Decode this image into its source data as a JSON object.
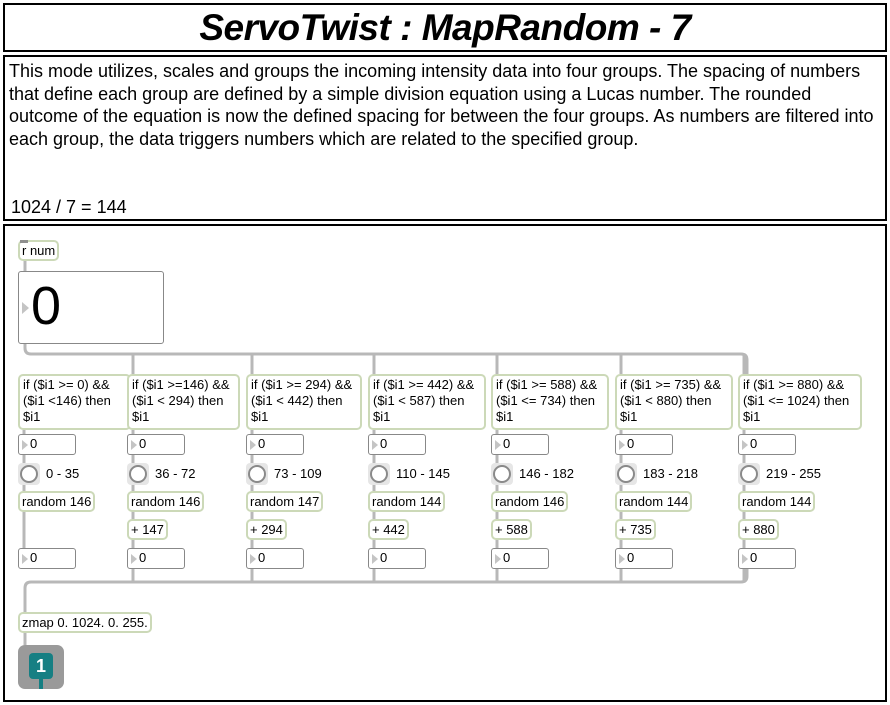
{
  "title": "ServoTwist : MapRandom - 7",
  "description": "This mode utilizes, scales and groups the incoming intensity data into four groups. The spacing of numbers that define each group are defined by a simple division equation using a Lucas number. The rounded outcome of the equation is now the defined spacing for between the four groups. As numbers are filtered into each group, the data triggers numbers which are related to the specified group.",
  "formula": "1024 / 7 = 144",
  "patch": {
    "receive": "r num",
    "big_number": "0",
    "columns": [
      {
        "expr": "if ($i1 >= 0) && ($i1 <146) then $i1",
        "num_in": "0",
        "range": "0 - 35",
        "random": "random 146",
        "add": "",
        "num_out": "0"
      },
      {
        "expr": "if ($i1 >=146) && ($i1 < 294) then $i1",
        "num_in": "0",
        "range": "36 - 72",
        "random": "random 146",
        "add": "+ 147",
        "num_out": "0"
      },
      {
        "expr": "if ($i1 >= 294) && ($i1 < 442) then $i1",
        "num_in": "0",
        "range": "73 - 109",
        "random": "random 147",
        "add": "+ 294",
        "num_out": "0"
      },
      {
        "expr": "if ($i1 >= 442) && ($i1 < 587) then $i1",
        "num_in": "0",
        "range": "110 - 145",
        "random": "random 144",
        "add": "+ 442",
        "num_out": "0"
      },
      {
        "expr": "if ($i1 >= 588) && ($i1 <= 734) then $i1",
        "num_in": "0",
        "range": "146 - 182",
        "random": "random 146",
        "add": "+ 588",
        "num_out": "0"
      },
      {
        "expr": "if ($i1 >= 735) && ($i1 < 880) then $i1",
        "num_in": "0",
        "range": "183 - 218",
        "random": "random 144",
        "add": "+ 735",
        "num_out": "0"
      },
      {
        "expr": "if ($i1 >= 880) && ($i1 <= 1024) then $i1",
        "num_in": "0",
        "range": "219 - 255",
        "random": "random 144",
        "add": "+ 880",
        "num_out": "0"
      }
    ],
    "zmap": "zmap 0. 1024. 0. 255.",
    "output_toggle": "1"
  },
  "colors": {
    "object_border": "#ccd9b8",
    "cord": "#b8b8b8",
    "toggle_fill": "#167f83"
  }
}
